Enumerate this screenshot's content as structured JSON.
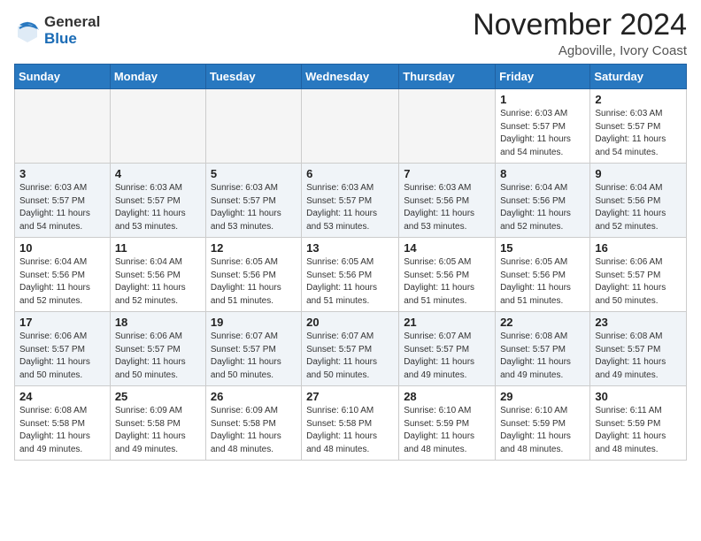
{
  "header": {
    "logo_general": "General",
    "logo_blue": "Blue",
    "month_title": "November 2024",
    "location": "Agboville, Ivory Coast"
  },
  "days_of_week": [
    "Sunday",
    "Monday",
    "Tuesday",
    "Wednesday",
    "Thursday",
    "Friday",
    "Saturday"
  ],
  "weeks": [
    {
      "id": "week1",
      "days": [
        {
          "date": "",
          "info": ""
        },
        {
          "date": "",
          "info": ""
        },
        {
          "date": "",
          "info": ""
        },
        {
          "date": "",
          "info": ""
        },
        {
          "date": "",
          "info": ""
        },
        {
          "date": "1",
          "info": "Sunrise: 6:03 AM\nSunset: 5:57 PM\nDaylight: 11 hours and 54 minutes."
        },
        {
          "date": "2",
          "info": "Sunrise: 6:03 AM\nSunset: 5:57 PM\nDaylight: 11 hours and 54 minutes."
        }
      ]
    },
    {
      "id": "week2",
      "days": [
        {
          "date": "3",
          "info": "Sunrise: 6:03 AM\nSunset: 5:57 PM\nDaylight: 11 hours and 54 minutes."
        },
        {
          "date": "4",
          "info": "Sunrise: 6:03 AM\nSunset: 5:57 PM\nDaylight: 11 hours and 53 minutes."
        },
        {
          "date": "5",
          "info": "Sunrise: 6:03 AM\nSunset: 5:57 PM\nDaylight: 11 hours and 53 minutes."
        },
        {
          "date": "6",
          "info": "Sunrise: 6:03 AM\nSunset: 5:57 PM\nDaylight: 11 hours and 53 minutes."
        },
        {
          "date": "7",
          "info": "Sunrise: 6:03 AM\nSunset: 5:56 PM\nDaylight: 11 hours and 53 minutes."
        },
        {
          "date": "8",
          "info": "Sunrise: 6:04 AM\nSunset: 5:56 PM\nDaylight: 11 hours and 52 minutes."
        },
        {
          "date": "9",
          "info": "Sunrise: 6:04 AM\nSunset: 5:56 PM\nDaylight: 11 hours and 52 minutes."
        }
      ]
    },
    {
      "id": "week3",
      "days": [
        {
          "date": "10",
          "info": "Sunrise: 6:04 AM\nSunset: 5:56 PM\nDaylight: 11 hours and 52 minutes."
        },
        {
          "date": "11",
          "info": "Sunrise: 6:04 AM\nSunset: 5:56 PM\nDaylight: 11 hours and 52 minutes."
        },
        {
          "date": "12",
          "info": "Sunrise: 6:05 AM\nSunset: 5:56 PM\nDaylight: 11 hours and 51 minutes."
        },
        {
          "date": "13",
          "info": "Sunrise: 6:05 AM\nSunset: 5:56 PM\nDaylight: 11 hours and 51 minutes."
        },
        {
          "date": "14",
          "info": "Sunrise: 6:05 AM\nSunset: 5:56 PM\nDaylight: 11 hours and 51 minutes."
        },
        {
          "date": "15",
          "info": "Sunrise: 6:05 AM\nSunset: 5:56 PM\nDaylight: 11 hours and 51 minutes."
        },
        {
          "date": "16",
          "info": "Sunrise: 6:06 AM\nSunset: 5:57 PM\nDaylight: 11 hours and 50 minutes."
        }
      ]
    },
    {
      "id": "week4",
      "days": [
        {
          "date": "17",
          "info": "Sunrise: 6:06 AM\nSunset: 5:57 PM\nDaylight: 11 hours and 50 minutes."
        },
        {
          "date": "18",
          "info": "Sunrise: 6:06 AM\nSunset: 5:57 PM\nDaylight: 11 hours and 50 minutes."
        },
        {
          "date": "19",
          "info": "Sunrise: 6:07 AM\nSunset: 5:57 PM\nDaylight: 11 hours and 50 minutes."
        },
        {
          "date": "20",
          "info": "Sunrise: 6:07 AM\nSunset: 5:57 PM\nDaylight: 11 hours and 50 minutes."
        },
        {
          "date": "21",
          "info": "Sunrise: 6:07 AM\nSunset: 5:57 PM\nDaylight: 11 hours and 49 minutes."
        },
        {
          "date": "22",
          "info": "Sunrise: 6:08 AM\nSunset: 5:57 PM\nDaylight: 11 hours and 49 minutes."
        },
        {
          "date": "23",
          "info": "Sunrise: 6:08 AM\nSunset: 5:57 PM\nDaylight: 11 hours and 49 minutes."
        }
      ]
    },
    {
      "id": "week5",
      "days": [
        {
          "date": "24",
          "info": "Sunrise: 6:08 AM\nSunset: 5:58 PM\nDaylight: 11 hours and 49 minutes."
        },
        {
          "date": "25",
          "info": "Sunrise: 6:09 AM\nSunset: 5:58 PM\nDaylight: 11 hours and 49 minutes."
        },
        {
          "date": "26",
          "info": "Sunrise: 6:09 AM\nSunset: 5:58 PM\nDaylight: 11 hours and 48 minutes."
        },
        {
          "date": "27",
          "info": "Sunrise: 6:10 AM\nSunset: 5:58 PM\nDaylight: 11 hours and 48 minutes."
        },
        {
          "date": "28",
          "info": "Sunrise: 6:10 AM\nSunset: 5:59 PM\nDaylight: 11 hours and 48 minutes."
        },
        {
          "date": "29",
          "info": "Sunrise: 6:10 AM\nSunset: 5:59 PM\nDaylight: 11 hours and 48 minutes."
        },
        {
          "date": "30",
          "info": "Sunrise: 6:11 AM\nSunset: 5:59 PM\nDaylight: 11 hours and 48 minutes."
        }
      ]
    }
  ]
}
